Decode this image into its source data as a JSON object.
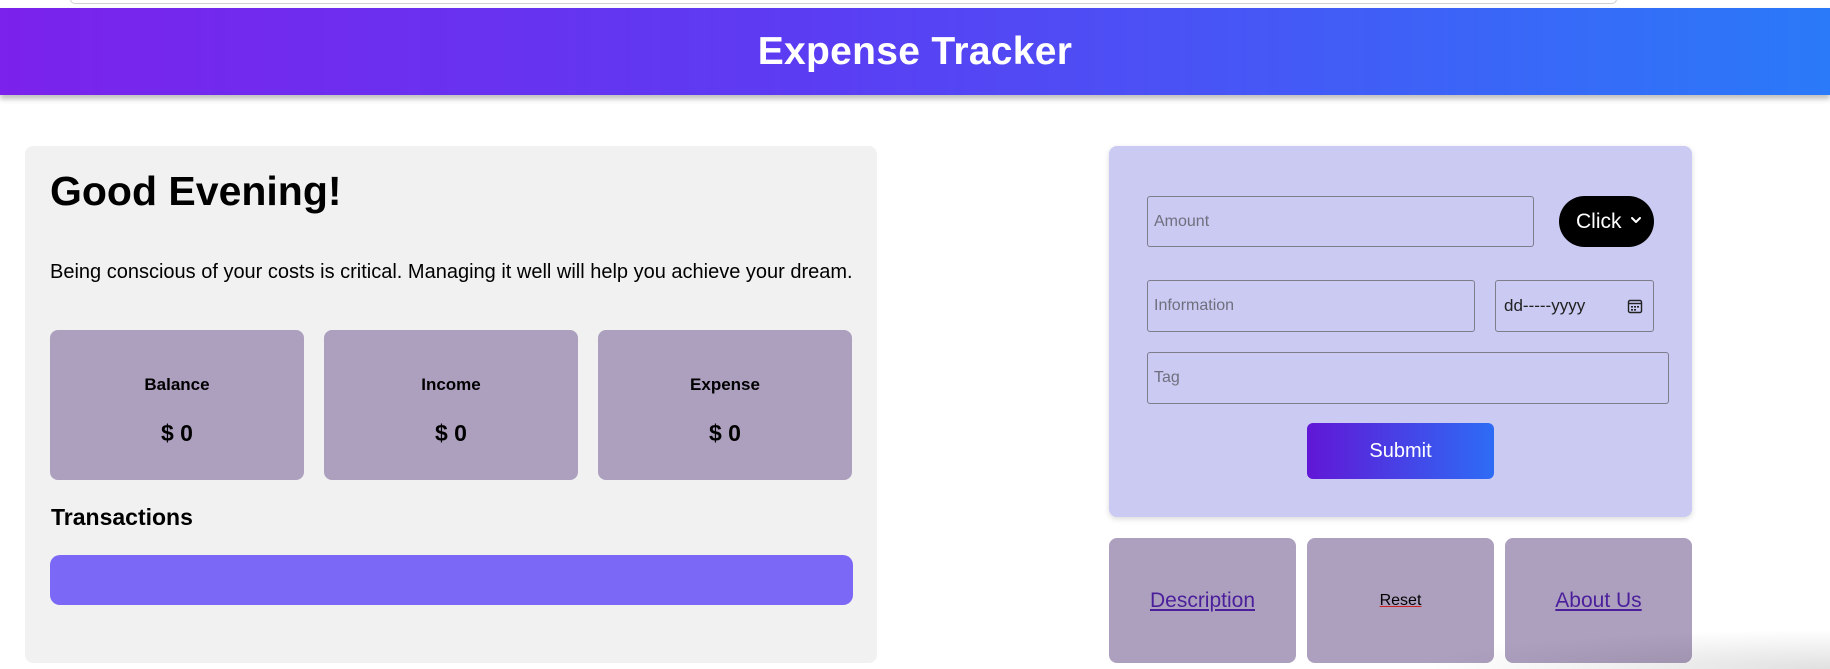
{
  "header": {
    "title": "Expense Tracker"
  },
  "summary": {
    "greeting": "Good Evening!",
    "tagline": "Being conscious of your costs is critical. Managing it well will help you achieve your dream.",
    "cards": [
      {
        "label": "Balance",
        "value": "$ 0"
      },
      {
        "label": "Income",
        "value": "$ 0"
      },
      {
        "label": "Expense",
        "value": "$ 0"
      }
    ],
    "transactions_title": "Transactions"
  },
  "form": {
    "amount_placeholder": "Amount",
    "type_select_value": "Click",
    "information_placeholder": "Information",
    "date_placeholder": "dd-----yyyy",
    "tag_placeholder": "Tag",
    "submit_label": "Submit"
  },
  "links": {
    "description_label": "Description",
    "reset_label": "Reset",
    "about_label": "About Us"
  },
  "icons": {
    "select": "chevron-down-icon",
    "date": "calendar-icon"
  },
  "colors": {
    "header_gradient_start": "#7b22ec",
    "header_gradient_end": "#2a7af9",
    "card_bg": "#ada0bf",
    "form_bg": "#cacaf2",
    "transactions_bar": "#7c68f6"
  }
}
